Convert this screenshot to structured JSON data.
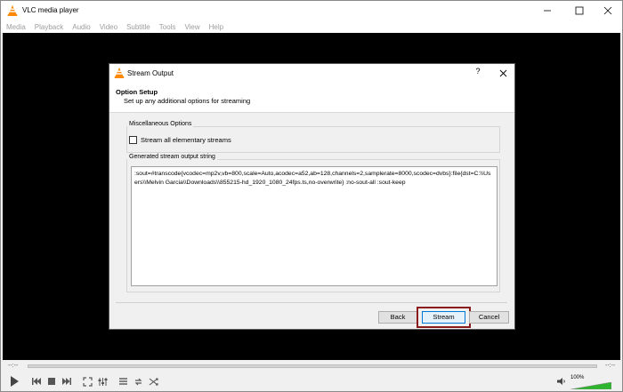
{
  "app": {
    "title": "VLC media player"
  },
  "menu": [
    "Media",
    "Playback",
    "Audio",
    "Video",
    "Subtitle",
    "Tools",
    "View",
    "Help"
  ],
  "dialog": {
    "title": "Stream Output",
    "help_label": "?",
    "section_title": "Option Setup",
    "section_subtitle": "Set up any additional options for streaming",
    "misc_group_label": "Miscellaneous Options",
    "stream_all_label": "Stream all elementary streams",
    "stream_all_checked": false,
    "generated_group_label": "Generated stream output string",
    "output_string": ":sout=#transcode{vcodec=mp2v,vb=800,scale=Auto,acodec=a52,ab=128,channels=2,samplerate=8000,scodec=dvbs}:file{dst=C:\\\\Users\\\\Melvin Garcia\\\\Downloads\\\\855215-hd_1920_1080_24fps.ts,no-overwrite} :no-sout-all :sout-keep",
    "back_label": "Back",
    "stream_label": "Stream",
    "cancel_label": "Cancel"
  },
  "player": {
    "time_elapsed": "--:--",
    "time_total": "--:--",
    "volume": "100%",
    "volume_level": 1.0
  },
  "colors": {
    "vlc_orange": "#ff8800",
    "highlight": "#8b1a1a",
    "volume_green": "#2db52d"
  }
}
